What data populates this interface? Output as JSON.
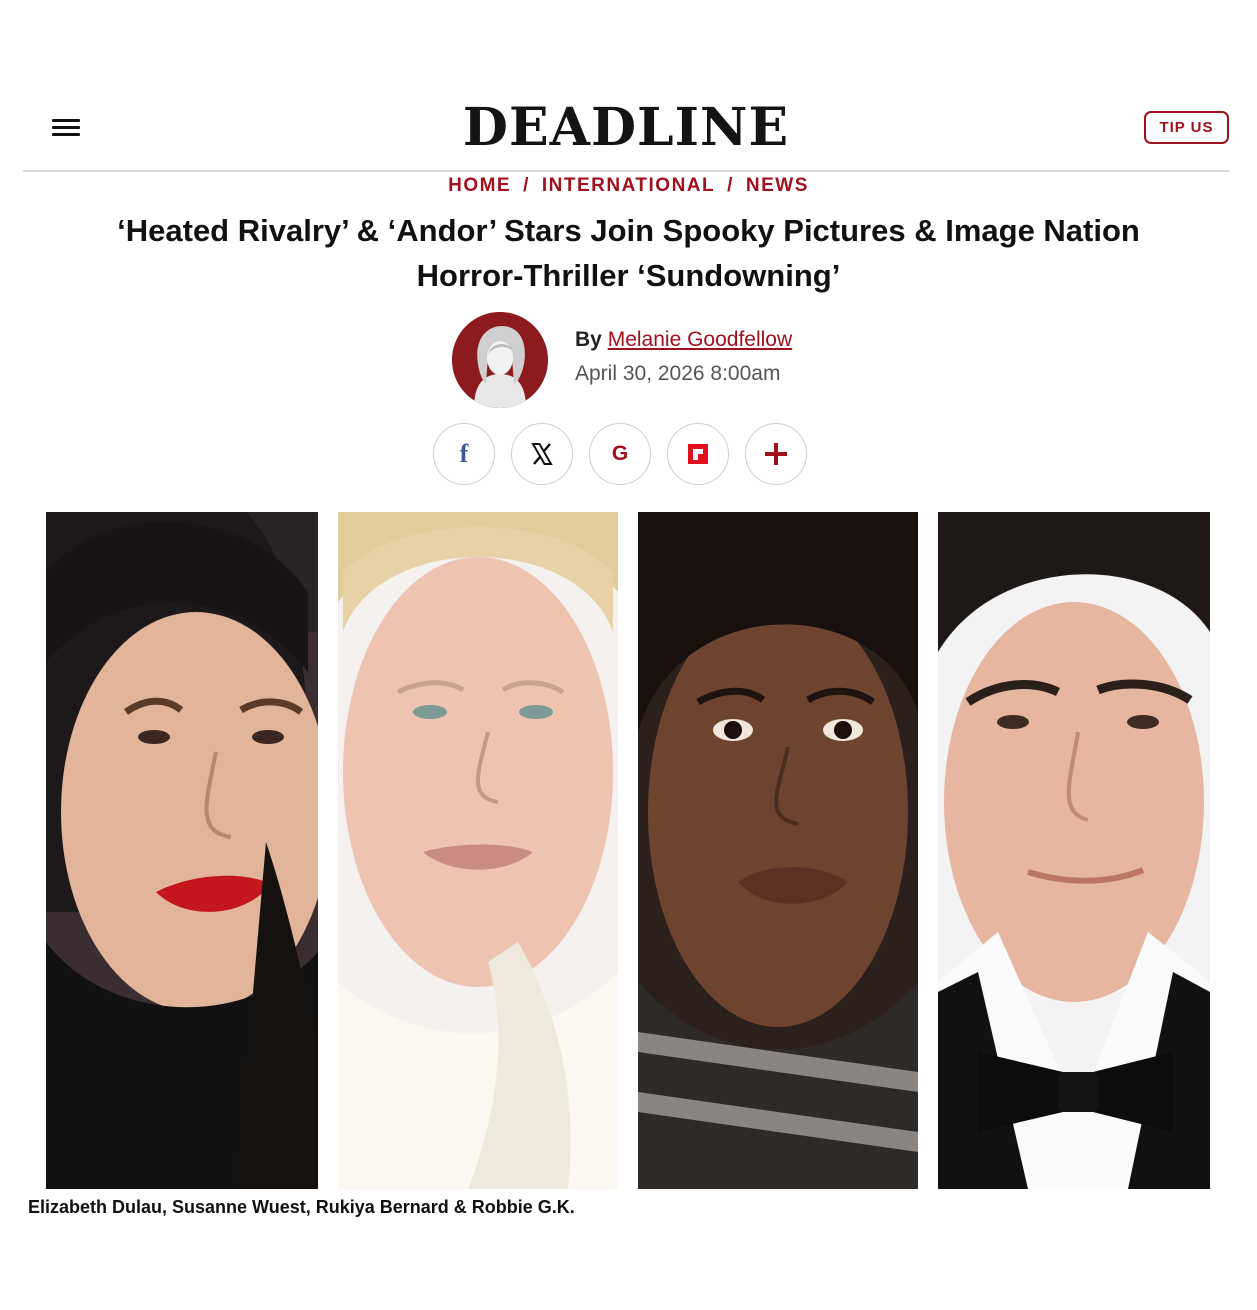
{
  "header": {
    "logo": "DEADLINE",
    "tip_us": "TIP US"
  },
  "breadcrumb": {
    "items": [
      "HOME",
      "INTERNATIONAL",
      "NEWS"
    ],
    "separator": "/"
  },
  "article": {
    "headline": "‘Heated Rivalry’ & ‘Andor’ Stars Join Spooky Pictures & Image Nation Horror-Thriller ‘Sundowning’",
    "by_label": "By",
    "author": "Melanie Goodfellow",
    "date": "April 30, 2026 8:00am",
    "caption": "Elizabeth Dulau, Susanne Wuest, Rukiya Bernard & Robbie G.K."
  },
  "share": {
    "facebook_glyph": "f",
    "google_glyph": "G"
  },
  "colors": {
    "brand_red": "#a0111c",
    "facebook_blue": "#3b5998",
    "text": "#111111",
    "muted": "#555555",
    "divider": "#d9d9d9"
  },
  "icons": [
    "menu-icon",
    "facebook-icon",
    "x-icon",
    "google-icon",
    "flipboard-icon",
    "plus-icon"
  ]
}
